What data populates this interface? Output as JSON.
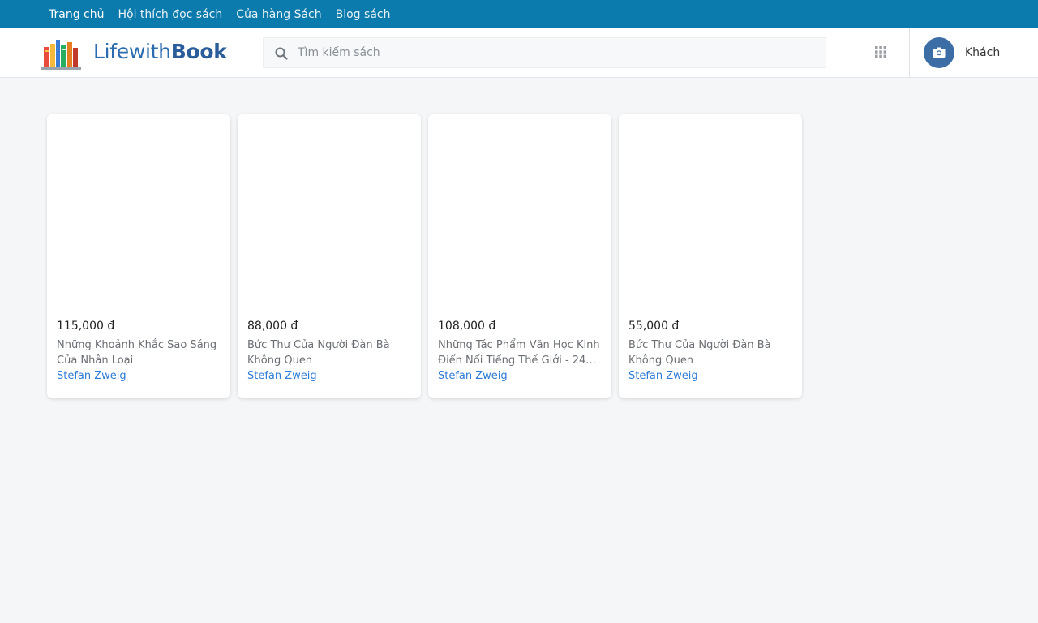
{
  "topnav": {
    "items": [
      {
        "label": "Trang chủ"
      },
      {
        "label": "Hội thích đọc sách"
      },
      {
        "label": "Cửa hàng Sách"
      },
      {
        "label": "Blog sách"
      }
    ]
  },
  "header": {
    "brand_prefix": "Lifewith",
    "brand_suffix": "Book",
    "logo_icon": "bookshelf-icon",
    "search_placeholder": "Tìm kiếm sách",
    "search_value": "",
    "user_name": "Khách"
  },
  "colors": {
    "topbar": "#0b7aac",
    "brand": "#2b6cb0",
    "author_link": "#2f7bd6",
    "avatar": "#3c6ea5"
  },
  "products": [
    {
      "price": "115,000 đ",
      "title": "Những Khoảnh Khắc Sao Sáng Của Nhân Loại",
      "author": "Stefan Zweig"
    },
    {
      "price": "88,000 đ",
      "title": "Bức Thư Của Người Đàn Bà Không Quen",
      "author": "Stefan Zweig"
    },
    {
      "price": "108,000 đ",
      "title": "Những Tác Phẩm Văn Học Kinh Điển Nổi Tiếng Thế Giới - 24...",
      "author": "Stefan Zweig"
    },
    {
      "price": "55,000 đ",
      "title": "Bức Thư Của Người Đàn Bà Không Quen",
      "author": "Stefan Zweig"
    }
  ]
}
